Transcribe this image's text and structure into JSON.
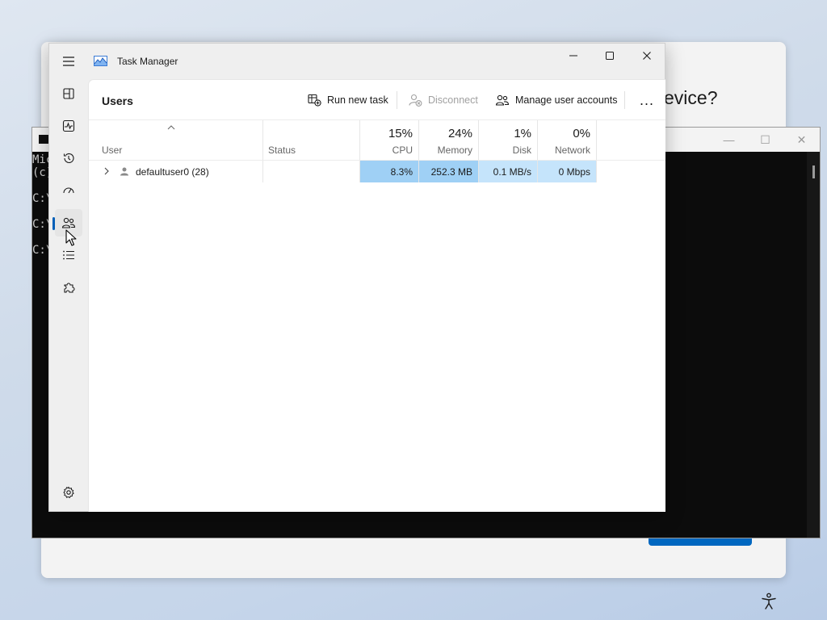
{
  "background": {
    "setup_heading": "evice?",
    "accent_color": "#0067c0"
  },
  "console": {
    "lines": [
      "Mic",
      "(c)",
      "C:\\",
      "C:\\",
      "C:\\"
    ],
    "controls": {
      "minimize": "—",
      "maximize": "☐",
      "close": "✕"
    }
  },
  "task_manager": {
    "title": "Task Manager",
    "controls": {
      "minimize": "—",
      "maximize": "☐",
      "close": "✕"
    },
    "nav": [
      {
        "name": "processes",
        "icon": "processes-icon"
      },
      {
        "name": "performance",
        "icon": "performance-icon"
      },
      {
        "name": "app-history",
        "icon": "history-icon"
      },
      {
        "name": "startup-apps",
        "icon": "startup-gauge-icon"
      },
      {
        "name": "users",
        "icon": "users-icon",
        "active": true
      },
      {
        "name": "details",
        "icon": "details-list-icon"
      },
      {
        "name": "services",
        "icon": "services-puzzle-icon"
      },
      {
        "name": "settings",
        "icon": "gear-icon"
      }
    ],
    "page_title": "Users",
    "toolbar": {
      "run_new_task": "Run new task",
      "disconnect": "Disconnect",
      "manage_user_accounts": "Manage user accounts",
      "more": "..."
    },
    "columns": {
      "user": "User",
      "status": "Status",
      "cpu": {
        "percent": "15%",
        "label": "CPU"
      },
      "memory": {
        "percent": "24%",
        "label": "Memory"
      },
      "disk": {
        "percent": "1%",
        "label": "Disk"
      },
      "network": {
        "percent": "0%",
        "label": "Network"
      }
    },
    "rows": [
      {
        "user": "defaultuser0 (28)",
        "status": "",
        "cpu": "8.3%",
        "memory": "252.3 MB",
        "disk": "0.1 MB/s",
        "network": "0 Mbps"
      }
    ]
  }
}
